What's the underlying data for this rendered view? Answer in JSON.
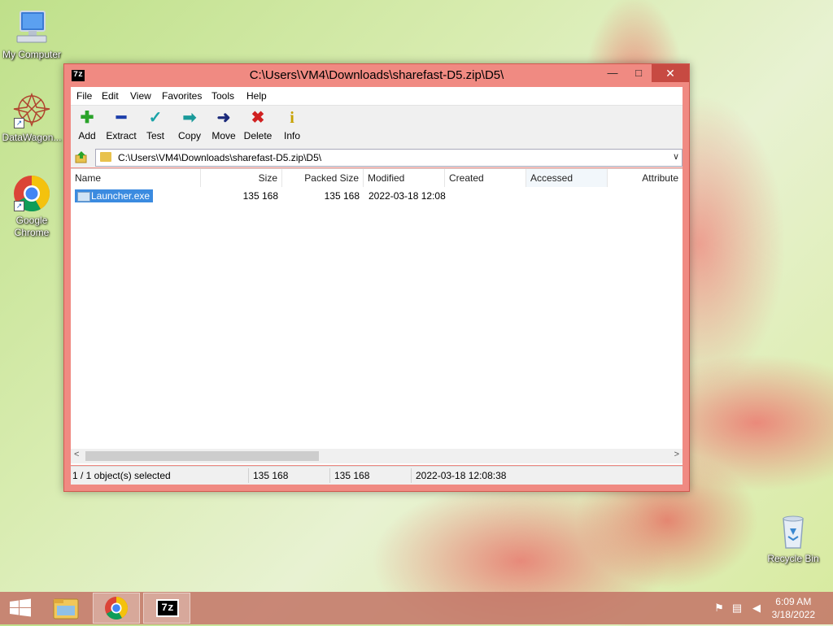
{
  "desktop": {
    "icons": [
      {
        "label": "My Computer"
      },
      {
        "label": "DataWagon..."
      },
      {
        "label": "Google Chrome"
      },
      {
        "label": "Recycle Bin"
      }
    ]
  },
  "window": {
    "app_icon_text": "7z",
    "title": "C:\\Users\\VM4\\Downloads\\sharefast-D5.zip\\D5\\",
    "buttons": {
      "minimize": "—",
      "maximize": "□",
      "close": "✕"
    }
  },
  "menu": [
    "File",
    "Edit",
    "View",
    "Favorites",
    "Tools",
    "Help"
  ],
  "toolbar": {
    "buttons": [
      {
        "label": "Add",
        "icon": "plus-icon",
        "glyph": "✚",
        "color": "#2aa32a"
      },
      {
        "label": "Extract",
        "icon": "minus-icon",
        "glyph": "━",
        "color": "#1d3faa"
      },
      {
        "label": "Test",
        "icon": "check-icon",
        "glyph": "✓",
        "color": "#1aa3a8"
      },
      {
        "label": "Copy",
        "icon": "copy-arrow-icon",
        "glyph": "➡",
        "color": "#1a9a9a"
      },
      {
        "label": "Move",
        "icon": "move-arrow-icon",
        "glyph": "➜",
        "color": "#1b2a7a"
      },
      {
        "label": "Delete",
        "icon": "delete-x-icon",
        "glyph": "✖",
        "color": "#d02020"
      },
      {
        "label": "Info",
        "icon": "info-icon",
        "glyph": "i",
        "color": "#c7a100"
      }
    ]
  },
  "address": {
    "path": "C:\\Users\\VM4\\Downloads\\sharefast-D5.zip\\D5\\",
    "dropdown": "∨"
  },
  "columns": [
    "Name",
    "Size",
    "Packed Size",
    "Modified",
    "Created",
    "Accessed",
    "Attribute"
  ],
  "files": [
    {
      "name": "Launcher.exe",
      "size": "135 168",
      "packed": "135 168",
      "modified": "2022-03-18 12:08",
      "created": "",
      "accessed": "",
      "attributes": ""
    }
  ],
  "status": {
    "selected": "1 / 1 object(s) selected",
    "size": "135 168",
    "packed": "135 168",
    "modified": "2022-03-18 12:08:38"
  },
  "scroll": {
    "left": "<",
    "right": ">"
  },
  "taskbar": {
    "seven_zip_label": "7z",
    "clock_time": "6:09 AM",
    "clock_date": "3/18/2022"
  }
}
